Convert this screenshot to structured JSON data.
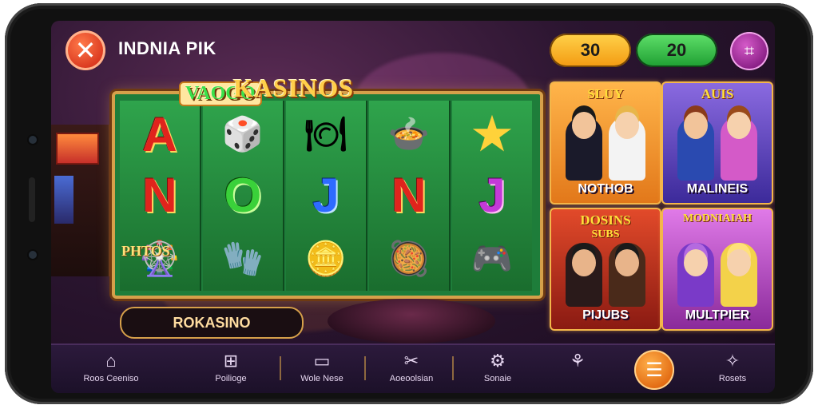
{
  "header": {
    "title": "INDNIA PIK",
    "close_icon": "close-icon",
    "balance_gold": "30",
    "balance_green": "20",
    "menu_icon": "grid-icon"
  },
  "slot": {
    "logo": "KASINOS",
    "sub_logo": "VAOGO",
    "badge": "PHTOS",
    "reels": [
      [
        "A",
        "N",
        "roulette"
      ],
      [
        "chip",
        "O",
        "glove"
      ],
      [
        "dish",
        "J",
        "coins"
      ],
      [
        "pot",
        "N",
        "bowl"
      ],
      [
        "star",
        "J",
        "gamepad"
      ]
    ]
  },
  "search": {
    "label": "ROKASINO"
  },
  "cards": [
    {
      "header": "SLUY",
      "footer": "NOTHOB",
      "bg": "#f3a53a"
    },
    {
      "header": "AUIS",
      "footer": "MALINEIS",
      "bg": "#6a4dc8"
    },
    {
      "header": "DOSINS",
      "subheader": "SUBS",
      "footer": "PIJUBS",
      "bg": "#d13a2a"
    },
    {
      "header": "MODNIAIAH",
      "footer": "MULTPIER",
      "bg": "#c85ad8"
    }
  ],
  "bottom_nav": {
    "items": [
      {
        "label": "Roos Ceeniso",
        "icon": "home-icon"
      },
      {
        "label": "Poilioge",
        "icon": "gift-icon"
      },
      {
        "label": "Wole Nese",
        "icon": "ticket-icon"
      },
      {
        "label": "Aoeoolsian",
        "icon": "tools-icon"
      },
      {
        "label": "Sonaie",
        "icon": "gear-icon"
      },
      {
        "label": "",
        "icon": "controller-icon"
      },
      {
        "label": "Rosets",
        "icon": "shapes-icon"
      }
    ],
    "fab_icon": "list-icon"
  }
}
